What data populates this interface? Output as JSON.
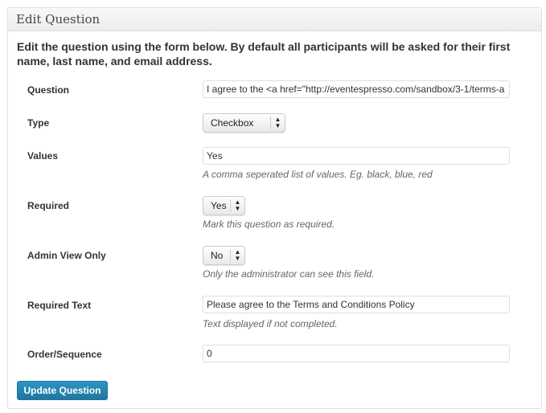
{
  "panel": {
    "title": "Edit Question",
    "intro": "Edit the question using the form below. By default all participants will be asked for their first name, last name, and email address."
  },
  "fields": {
    "question": {
      "label": "Question",
      "value": "I agree to the <a href=\"http://eventespresso.com/sandbox/3-1/terms-a"
    },
    "type": {
      "label": "Type",
      "value": "Checkbox"
    },
    "values": {
      "label": "Values",
      "value": "Yes",
      "desc": "A comma seperated list of values. Eg. black, blue, red"
    },
    "required": {
      "label": "Required",
      "value": "Yes",
      "desc": "Mark this question as required."
    },
    "admin_only": {
      "label": "Admin View Only",
      "value": "No",
      "desc": "Only the administrator can see this field."
    },
    "required_text": {
      "label": "Required Text",
      "value": "Please agree to the Terms and Conditions Policy",
      "desc": "Text displayed if not completed."
    },
    "order": {
      "label": "Order/Sequence",
      "value": "0"
    }
  },
  "submit_label": "Update Question",
  "colors": {
    "button": "#21759b"
  },
  "icons": {
    "select_arrow": "up-down-arrows-icon"
  }
}
